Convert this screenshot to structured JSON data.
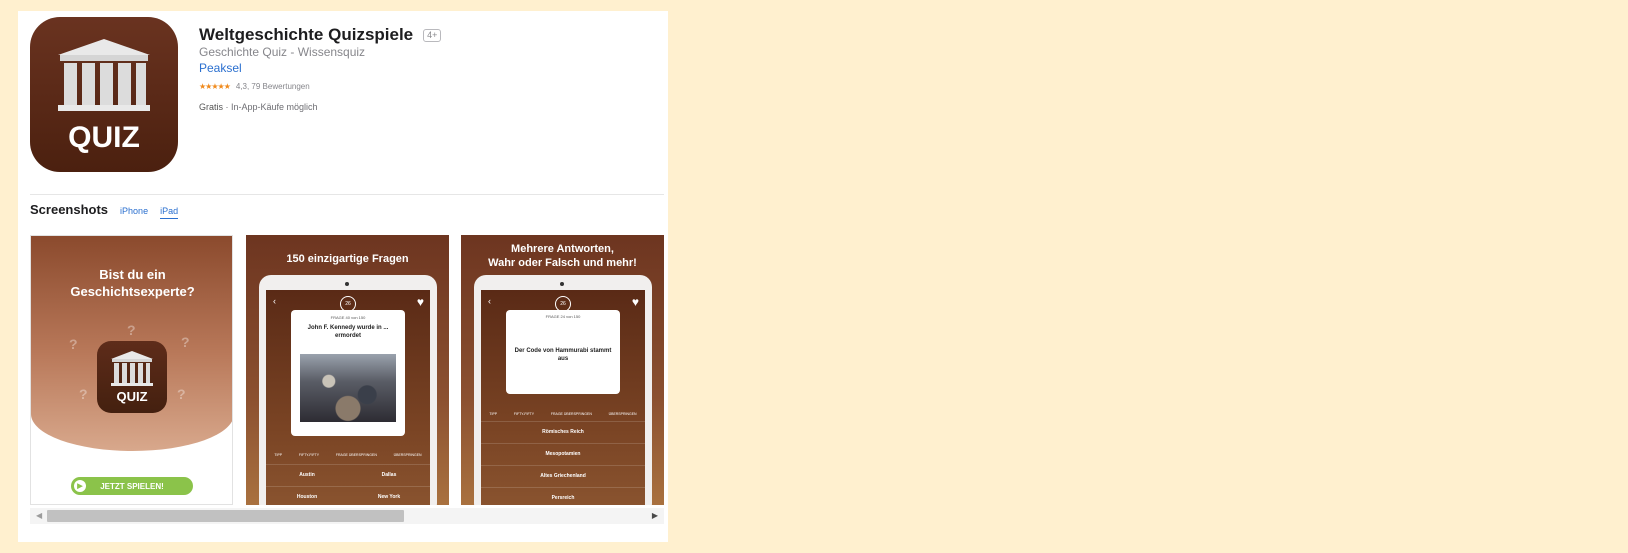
{
  "app": {
    "title": "Weltgeschichte Quizspiele",
    "age_rating": "4+",
    "subtitle": "Geschichte Quiz - Wissensquiz",
    "developer": "Peaksel",
    "stars": "★★★★★",
    "rating_text": "4,3, 79 Bewertungen",
    "price": "Gratis",
    "price_note": " · In-App-Käufe möglich",
    "icon_label": "QUIZ"
  },
  "screenshots": {
    "title": "Screenshots",
    "tabs": [
      {
        "label": "iPhone"
      },
      {
        "label": "iPad"
      }
    ],
    "shot1": {
      "heading_line1": "Bist du ein",
      "heading_line2": "Geschichtsexperte?",
      "icon_label": "QUIZ",
      "button": "JETZT SPIELEN!"
    },
    "shot2": {
      "caption": "150 einzigartige Fragen",
      "timer": "26",
      "counter": "FRAGE 40 von 150",
      "question": "John F. Kennedy wurde in ... ermordet",
      "jokers": [
        "TIPP",
        "FIFTY-FIFTY",
        "FRAGE ÜBERSPRINGEN",
        "ÜBERSPRINGEN"
      ],
      "answers": [
        "Austin",
        "Dallas",
        "Houston",
        "New York"
      ]
    },
    "shot3": {
      "caption_line1": "Mehrere Antworten,",
      "caption_line2": "Wahr oder Falsch und mehr!",
      "timer": "26",
      "counter": "FRAGE 24 von 150",
      "question": "Der Code von Hammurabi stammt aus",
      "jokers": [
        "TIPP",
        "FIFTY-FIFTY",
        "FRAGE ÜBERSPRINGEN",
        "ÜBERSPRINGEN"
      ],
      "answers": [
        "Römisches Reich",
        "Mesopotamien",
        "Altes Griechenland",
        "Persreich"
      ]
    }
  },
  "colors": {
    "accent": "#2a6fcf",
    "page_bg": "#fff0cf",
    "icon_brown": "#4b200f",
    "play_green": "#8bc34a",
    "star_orange": "#f08a1c"
  },
  "icons": {
    "app": "temple-icon",
    "play": "play-icon",
    "heart": "heart-icon",
    "back": "chevron-left-icon",
    "scroll_left": "arrow-left-icon",
    "scroll_right": "arrow-right-icon"
  }
}
